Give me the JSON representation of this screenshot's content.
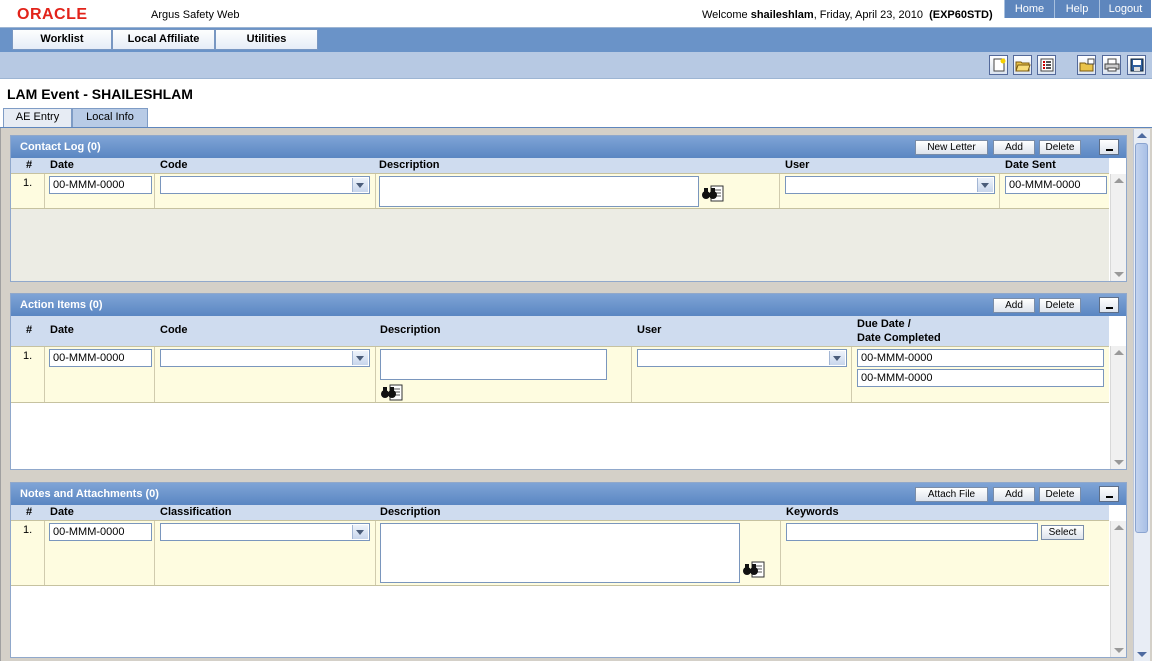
{
  "header": {
    "logo": "ORACLE",
    "app_name": "Argus Safety Web",
    "welcome_prefix": "Welcome ",
    "user": "shaileshlam",
    "date": ", Friday, April 23, 2010",
    "env": "(EXP60STD)",
    "nav": [
      "Home",
      "Help",
      "Logout"
    ]
  },
  "menu": [
    "Worklist",
    "Local Affiliate",
    "Utilities"
  ],
  "toolbar_icons": [
    "new-icon",
    "open-icon",
    "list-icon",
    "export-icon",
    "print-icon",
    "save-icon"
  ],
  "page": {
    "title": "LAM Event - SHAILESHLAM"
  },
  "tabs": [
    "AE Entry",
    "Local Info"
  ],
  "contact_log": {
    "title": "Contact Log (0)",
    "buttons": [
      "New Letter",
      "Add",
      "Delete"
    ],
    "columns": [
      "#",
      "Date",
      "Code",
      "Description",
      "User",
      "Date Sent"
    ],
    "row": {
      "num": "1.",
      "date": "00-MMM-0000",
      "date_sent": "00-MMM-0000"
    }
  },
  "action_items": {
    "title": "Action Items (0)",
    "buttons": [
      "Add",
      "Delete"
    ],
    "columns": [
      "#",
      "Date",
      "Code",
      "Description",
      "User"
    ],
    "due_col": [
      "Due Date /",
      "Date Completed"
    ],
    "row": {
      "num": "1.",
      "date": "00-MMM-0000",
      "due_date": "00-MMM-0000",
      "date_completed": "00-MMM-0000"
    }
  },
  "notes": {
    "title": "Notes and Attachments (0)",
    "buttons": [
      "Attach File",
      "Add",
      "Delete"
    ],
    "columns": [
      "#",
      "Date",
      "Classification",
      "Description",
      "Keywords"
    ],
    "row": {
      "num": "1.",
      "date": "00-MMM-0000"
    },
    "select_label": "Select"
  }
}
